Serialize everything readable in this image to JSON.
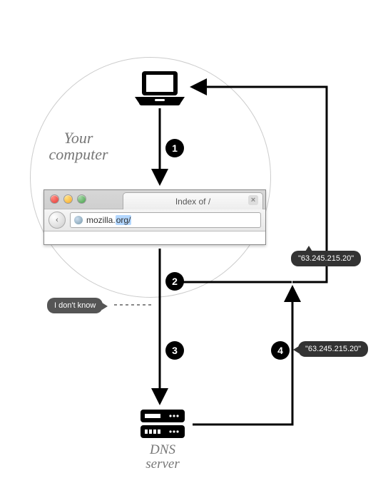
{
  "labels": {
    "computer_line1": "Your",
    "computer_line2": "computer",
    "dns_line1": "DNS",
    "dns_line2": "server"
  },
  "steps": {
    "s1": "1",
    "s2": "2",
    "s3": "3",
    "s4": "4"
  },
  "bubbles": {
    "dont_know": "I don't know",
    "ip_top": "\"63.245.215.20\"",
    "ip_bottom": "\"63.245.215.20\""
  },
  "browser": {
    "tab": "Index of /",
    "close": "×",
    "url_host": "mozilla.",
    "url_rest": "org/",
    "back_glyph": "‹"
  },
  "icons": {
    "laptop": "laptop-icon",
    "server": "server-icon"
  }
}
